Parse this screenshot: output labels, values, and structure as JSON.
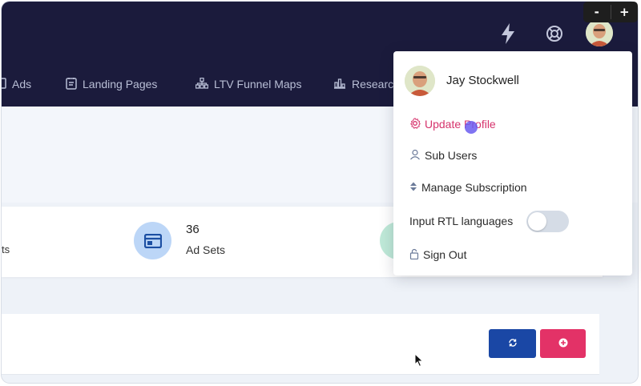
{
  "zoom": {
    "minus": "-",
    "plus": "+"
  },
  "topbar": {
    "icons": [
      "bolt-icon",
      "help-icon",
      "avatar"
    ],
    "background": "#1b1b3c"
  },
  "nav": {
    "items": [
      {
        "label": "Ads",
        "icon": "ads-icon"
      },
      {
        "label": "Landing Pages",
        "icon": "landing-pages-icon"
      },
      {
        "label": "LTV Funnel Maps",
        "icon": "funnel-maps-icon"
      },
      {
        "label": "Researc",
        "icon": "research-icon"
      }
    ]
  },
  "stats": {
    "cut_label": "ts",
    "adsets_count": "36",
    "adsets_label": "Ad Sets"
  },
  "buttons": {
    "refresh_icon": "refresh-icon",
    "add_icon": "plus-circle-icon",
    "refresh_color": "#1a47a5",
    "add_color": "#e33267"
  },
  "profile_menu": {
    "name": "Jay Stockwell",
    "items": [
      {
        "label": "Update Profile",
        "icon": "gear-icon",
        "active": true
      },
      {
        "label": "Sub Users",
        "icon": "user-icon"
      },
      {
        "label": "Manage Subscription",
        "icon": "sort-icon"
      },
      {
        "label": "Input RTL languages",
        "toggle": false
      },
      {
        "label": "Sign Out",
        "icon": "lock-icon"
      }
    ],
    "accent": "#d6336c"
  }
}
